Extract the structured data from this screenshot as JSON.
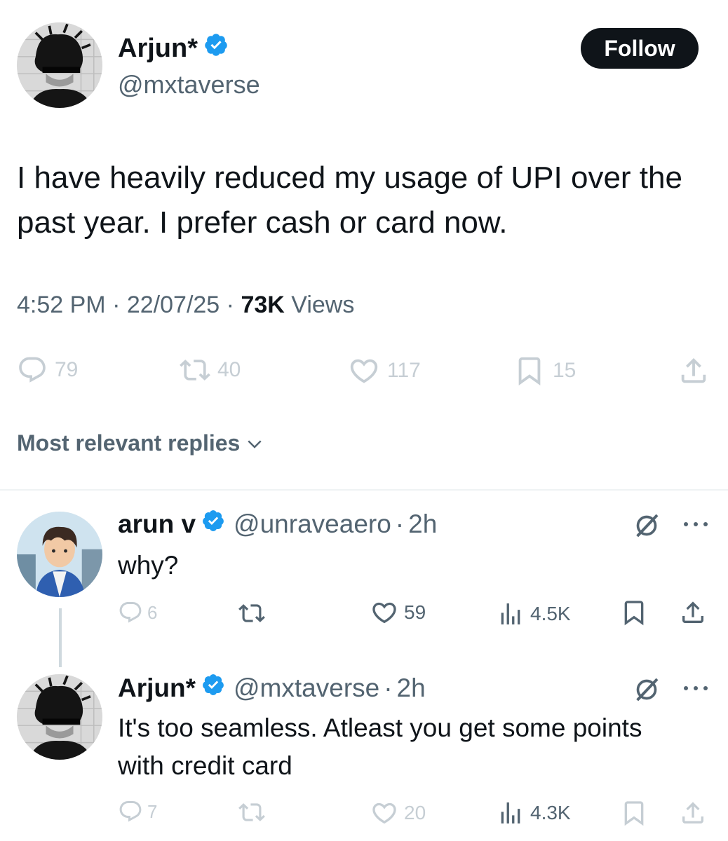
{
  "main_tweet": {
    "author_name": "Arjun*",
    "author_handle": "@mxtaverse",
    "follow_label": "Follow",
    "text": "I have heavily reduced my usage of UPI over the past year. I prefer cash or card now.",
    "time": "4:52 PM",
    "date": "22/07/25",
    "views_count": "73K",
    "views_label": "Views",
    "stats": {
      "replies": "79",
      "reposts": "40",
      "likes": "117",
      "bookmarks": "15"
    }
  },
  "replies_section": {
    "label": "Most relevant replies"
  },
  "replies": [
    {
      "author_name": "arun v",
      "author_handle": "@unraveaero",
      "time": "2h",
      "text": "why?",
      "stats": {
        "replies": "6",
        "reposts": "",
        "likes": "59",
        "views": "4.5K"
      }
    },
    {
      "author_name": "Arjun*",
      "author_handle": "@mxtaverse",
      "time": "2h",
      "text": "It's too seamless. Atleast you get some points with credit card",
      "stats": {
        "replies": "7",
        "reposts": "",
        "likes": "20",
        "views": "4.3K"
      }
    }
  ],
  "colors": {
    "verified": "#1d9bf0",
    "text": "#0f1419",
    "muted": "#536471",
    "faded_icon": "#c6ced4"
  },
  "separator": "·"
}
